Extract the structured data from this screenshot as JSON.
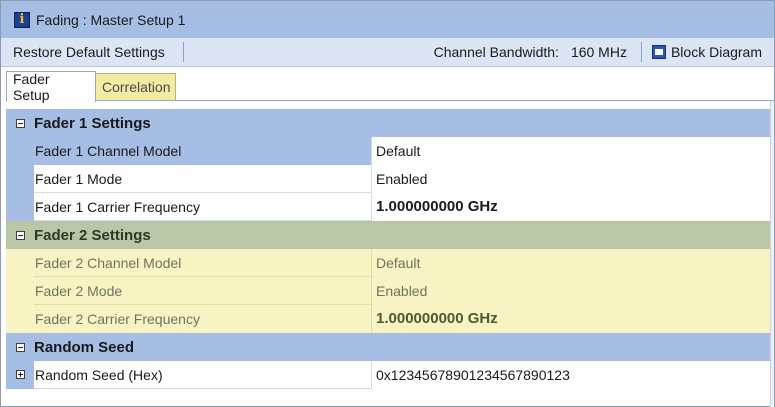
{
  "window": {
    "title": "Fading : Master Setup 1",
    "icon": "info-icon",
    "colors": {
      "header": "#a6bde4",
      "toolbar": "#dbe5f5",
      "alt_band": "#f7f3c2",
      "alt_category": "#bac7a7"
    }
  },
  "toolbar": {
    "restore_label": "Restore Default Settings",
    "bandwidth_label": "Channel Bandwidth:",
    "bandwidth_value": "160 MHz",
    "block_diagram_label": "Block Diagram",
    "block_diagram_icon": "block-diagram-icon"
  },
  "tabs": [
    {
      "label": "Fader Setup",
      "active": true
    },
    {
      "label": "Correlation",
      "active": false
    }
  ],
  "groups": [
    {
      "label": "Fader 1 Settings",
      "expanded": true,
      "items": [
        {
          "name": "Fader 1 Channel Model",
          "value": "Default"
        },
        {
          "name": "Fader 1 Mode",
          "value": "Enabled"
        },
        {
          "name": "Fader 1 Carrier Frequency",
          "value": "1.000000000 GHz"
        }
      ]
    },
    {
      "label": "Fader 2 Settings",
      "expanded": true,
      "items": [
        {
          "name": "Fader 2 Channel Model",
          "value": "Default"
        },
        {
          "name": "Fader 2 Mode",
          "value": "Enabled"
        },
        {
          "name": "Fader 2 Carrier Frequency",
          "value": "1.000000000 GHz"
        }
      ]
    },
    {
      "label": "Random Seed",
      "expanded": true,
      "items": [
        {
          "name": "Random Seed (Hex)",
          "value": "0x12345678901234567890123"
        }
      ]
    }
  ]
}
